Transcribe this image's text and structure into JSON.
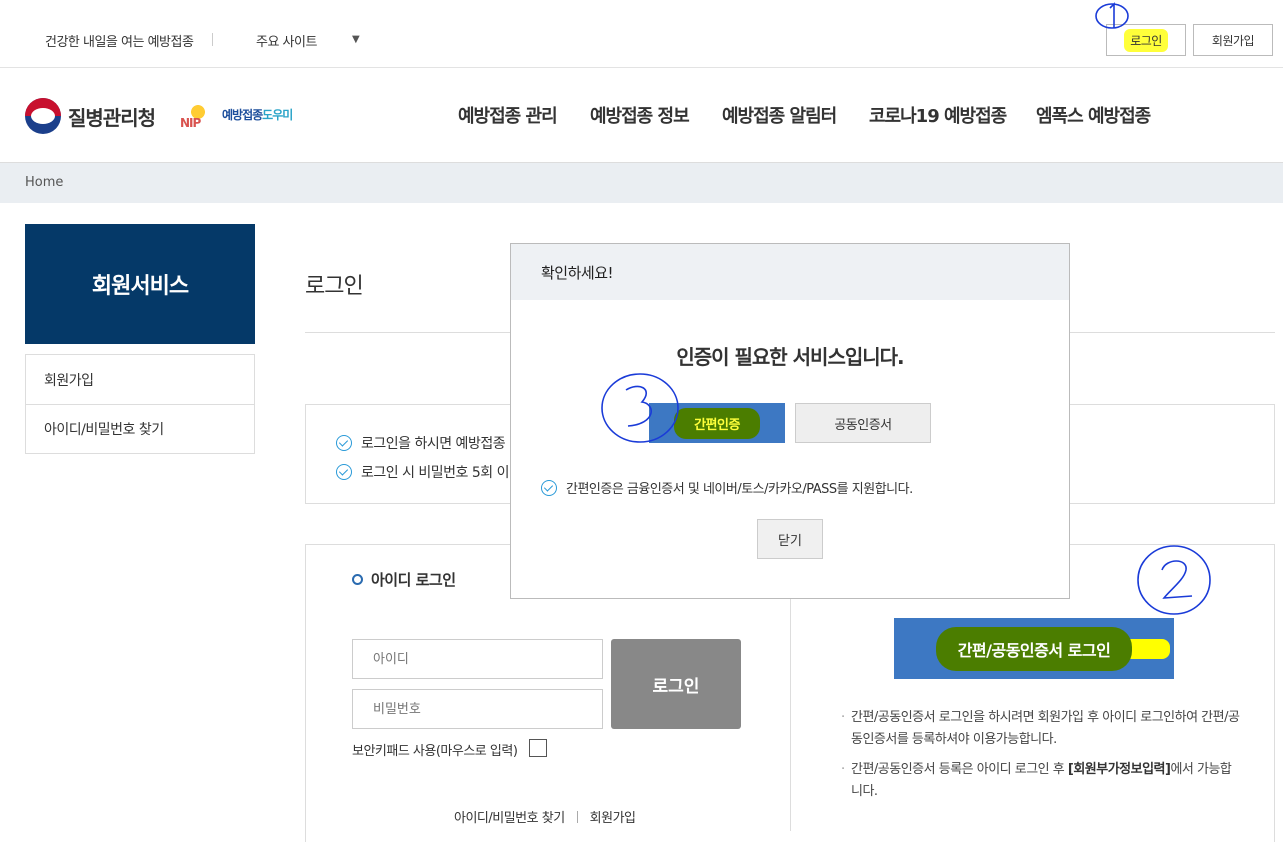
{
  "topbar": {
    "slogan": "건강한 내일을 여는 예방접종",
    "sites_label": "주요 사이트",
    "sites_arrow": "▼",
    "login_label": "로그인",
    "join_label": "회원가입"
  },
  "header": {
    "agency_name": "질병관리청",
    "nip_badge": "NIP",
    "nip_name_a": "예방접종",
    "nip_name_b": "도우미",
    "nav": [
      "예방접종 관리",
      "예방접종 정보",
      "예방접종 알림터",
      "코로나19 예방접종",
      "엠폭스 예방접종"
    ]
  },
  "breadcrumb": {
    "home": "Home"
  },
  "sidebar": {
    "title": "회원서비스",
    "items": [
      "회원가입",
      "아이디/비밀번호 찾기"
    ]
  },
  "content": {
    "title": "로그인",
    "info": [
      "로그인을 하시면 예방접종",
      "로그인 시 비밀번호 5회 이"
    ],
    "id_login_title": "아이디 로그인",
    "id_placeholder": "아이디",
    "pw_placeholder": "비밀번호",
    "login_button": "로그인",
    "keypad_label": "보안키패드 사용(마우스로 입력)",
    "find_link": "아이디/비밀번호 찾기",
    "join_link": "회원가입",
    "cert_button": "간편/공동인증서 로그인",
    "cert_note_1": "간편/공동인증서 로그인을 하시려면 회원가입 후 아이디 로그인하여 간편/공동인증서를 등록하셔야 이용가능합니다.",
    "cert_note_2_a": "간편/공동인증서 등록은 아이디 로그인 후 ",
    "cert_note_2_b": "[회원부가정보입력]",
    "cert_note_2_c": "에서 가능합니다."
  },
  "modal": {
    "title": "확인하세요!",
    "message": "인증이 필요한 서비스입니다.",
    "simple_auth": "간편인증",
    "public_cert": "공동인증서",
    "note": "간편인증은 금융인증서 및 네이버/토스/카카오/PASS를 지원합니다.",
    "close": "닫기"
  },
  "colors": {
    "sidebar_title_bg": "#053968",
    "cert_button_bg": "#3d78c3",
    "highlight_yellow": "#ffff3a",
    "highlight_green": "#4b7d00",
    "annotation_pen": "#1a3bd8"
  }
}
